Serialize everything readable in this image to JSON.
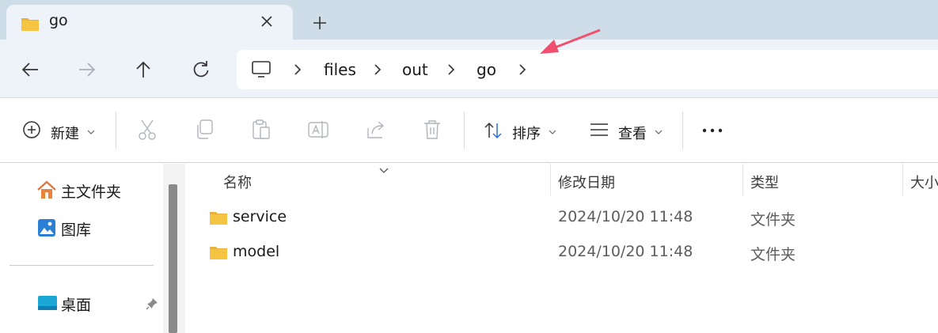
{
  "tab": {
    "title": "go",
    "icon": "folder-icon",
    "close_icon": "close-icon"
  },
  "new_tab_icon": "plus-icon",
  "nav": {
    "back": "arrow-left-icon",
    "forward": "arrow-right-icon",
    "up": "arrow-up-icon",
    "refresh": "refresh-icon"
  },
  "breadcrumb": {
    "root_icon": "this-pc-icon",
    "items": [
      "files",
      "out",
      "go"
    ]
  },
  "toolbar": {
    "new_label": "新建",
    "sort_label": "排序",
    "view_label": "查看"
  },
  "sidebar": {
    "items": [
      {
        "label": "主文件夹",
        "icon": "home-icon"
      },
      {
        "label": "图库",
        "icon": "gallery-icon"
      },
      {
        "label": "桌面",
        "icon": "desktop-icon"
      }
    ]
  },
  "columns": {
    "name": "名称",
    "modified": "修改日期",
    "type": "类型",
    "size": "大小"
  },
  "files": [
    {
      "name": "service",
      "modified": "2024/10/20 11:48",
      "type": "文件夹"
    },
    {
      "name": "model",
      "modified": "2024/10/20 11:48",
      "type": "文件夹"
    }
  ],
  "colors": {
    "tab_strip": "#cfdde9",
    "toolbar_bg": "#eef3f9",
    "folder": "#f5c542",
    "annotation_arrow": "#f0506e"
  }
}
